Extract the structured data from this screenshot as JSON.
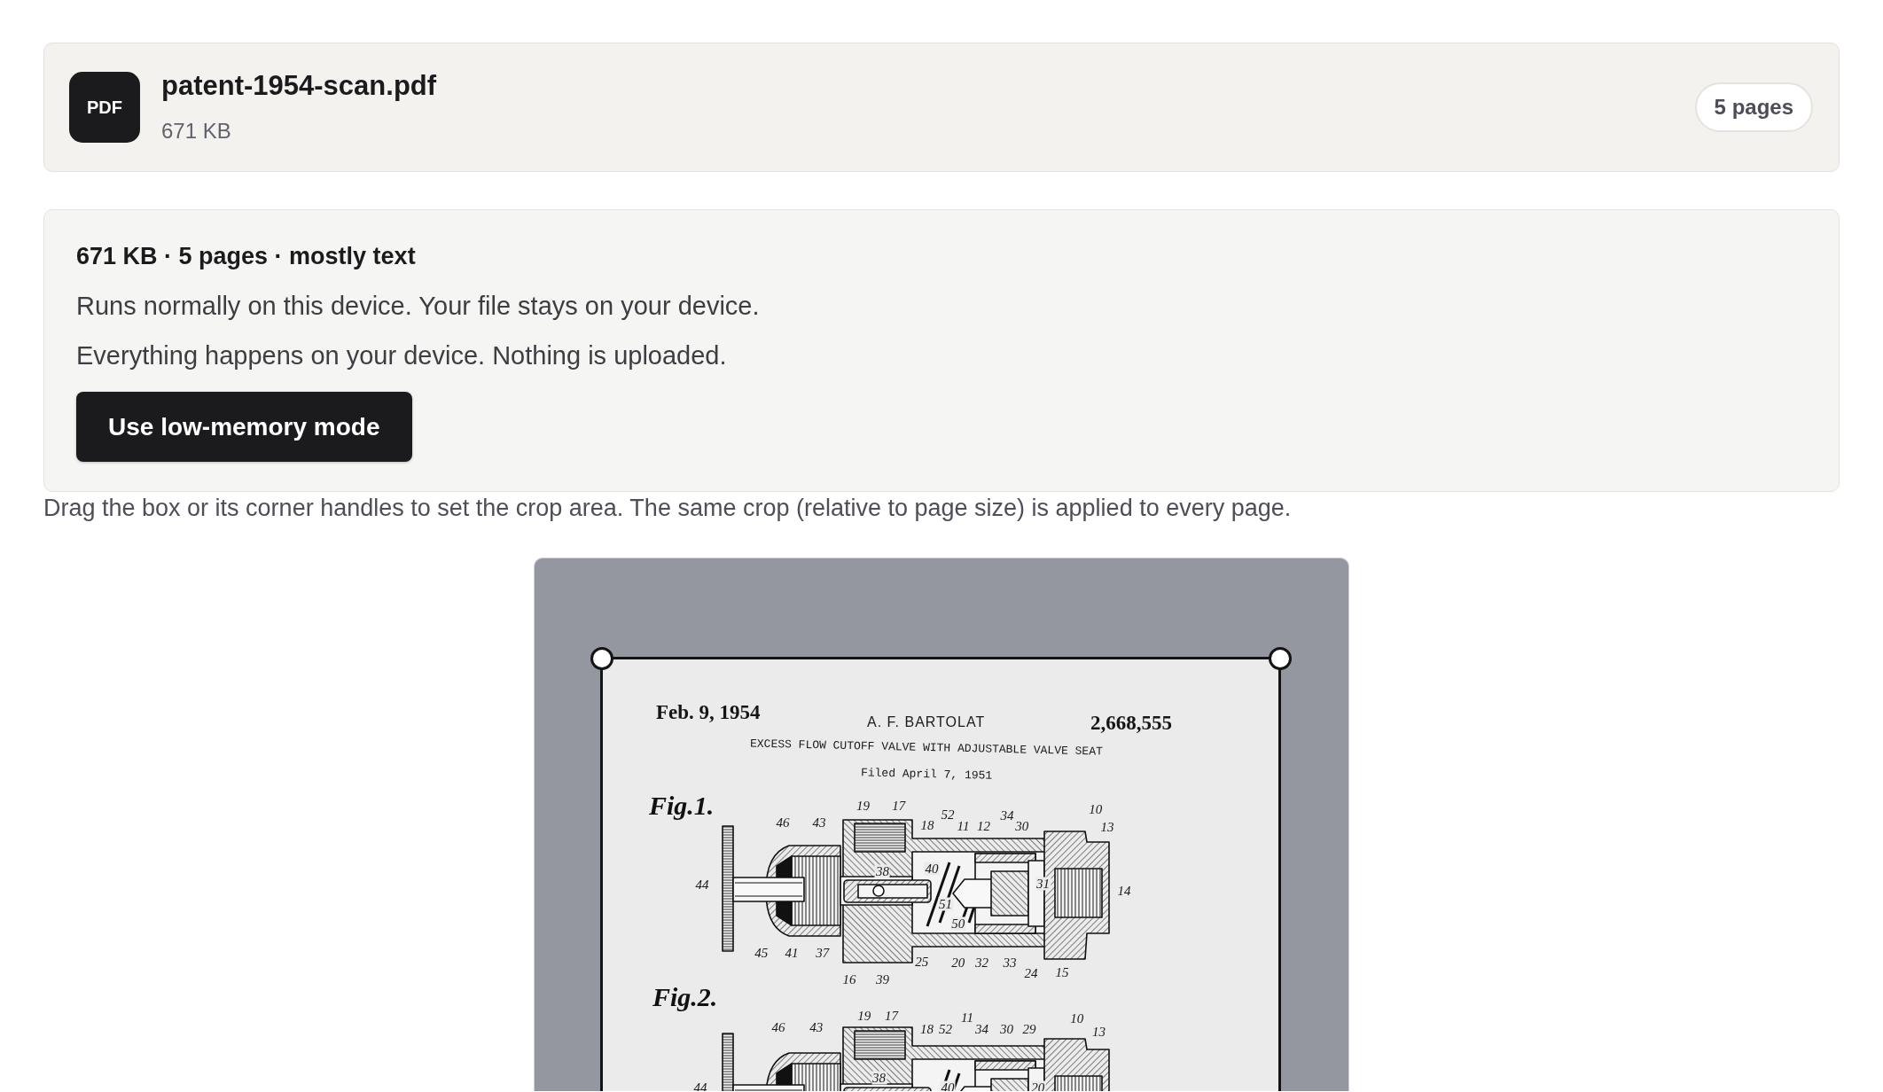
{
  "file": {
    "type_label": "PDF",
    "name": "patent-1954-scan.pdf",
    "size": "671 KB",
    "page_count": "5 pages"
  },
  "device_check": {
    "summary": "671 KB · 5 pages · mostly text",
    "messages": [
      "Runs normally on this device. Your file stays on your device.",
      "Everything happens on your device. Nothing is uploaded."
    ],
    "button": "Use low-memory mode"
  },
  "crop": {
    "instructions": "Drag the box or its corner handles to set the crop area. The same crop (relative to page size) is applied to every page.",
    "page": {
      "date": "Feb. 9, 1954",
      "inventor": "A. F. BARTOLAT",
      "patent_number": "2,668,555",
      "title": "EXCESS FLOW CUTOFF VALVE WITH ADJUSTABLE VALVE SEAT",
      "filed": "Filed April 7, 1951",
      "figures": [
        {
          "label": "Fig.1.",
          "reference_numerals": [
            "19",
            "17",
            "46",
            "43",
            "18",
            "52",
            "11",
            "12",
            "34",
            "30",
            "10",
            "13",
            "38",
            "40",
            "44",
            "31",
            "14",
            "51",
            "50",
            "45",
            "41",
            "37",
            "25",
            "20",
            "32",
            "33",
            "24",
            "15",
            "16",
            "39"
          ]
        },
        {
          "label": "Fig.2.",
          "reference_numerals": [
            "19",
            "17",
            "11",
            "10",
            "46",
            "43",
            "18",
            "52",
            "34",
            "30",
            "29",
            "13",
            "38",
            "44",
            "40",
            "20"
          ]
        }
      ]
    }
  }
}
